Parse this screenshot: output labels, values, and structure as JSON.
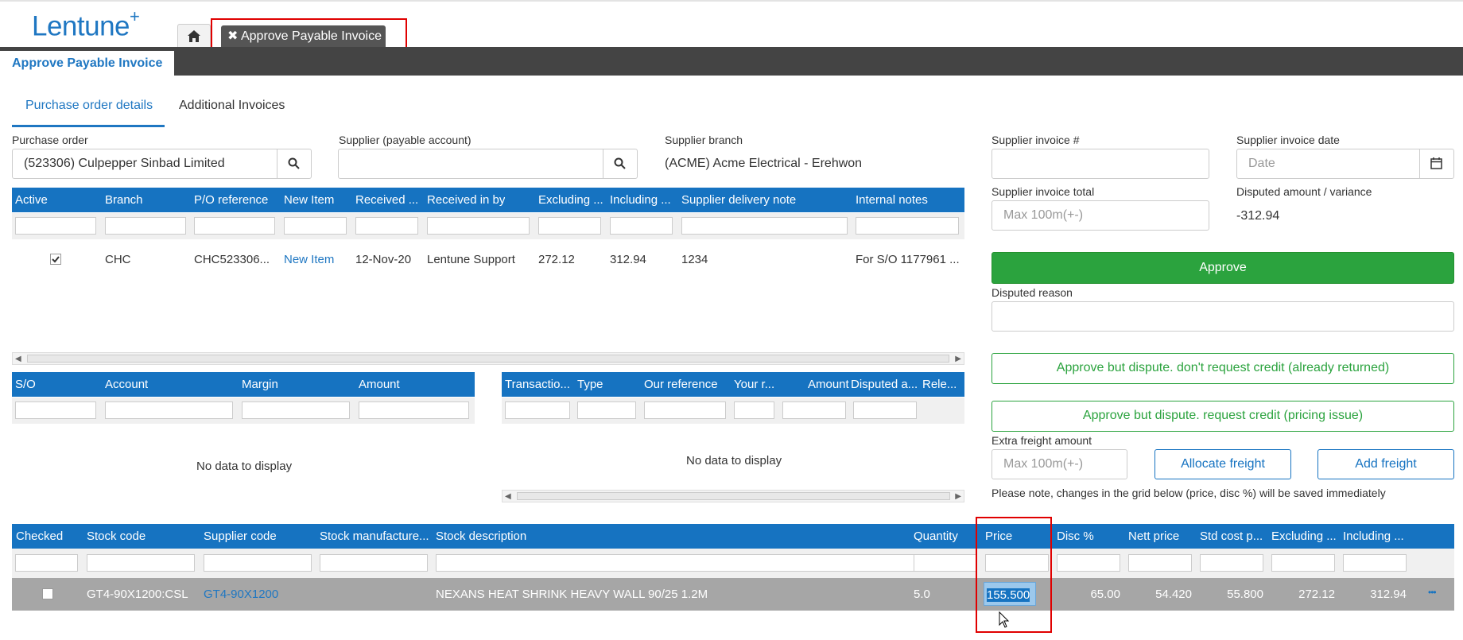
{
  "app": {
    "logo_text": "Lentune",
    "logo_plus": "+"
  },
  "tabs": {
    "home_icon": "home-icon",
    "active_label": "✖ Approve Payable Invoice"
  },
  "page_tab": "Approve Payable Invoice",
  "subtabs": [
    "Purchase order details",
    "Additional Invoices"
  ],
  "fields": {
    "purchase_order_label": "Purchase order",
    "purchase_order_value": "(523306) Culpepper Sinbad Limited",
    "supplier_label": "Supplier (payable account)",
    "supplier_value": "",
    "supplier_branch_label": "Supplier branch",
    "supplier_branch_value": "(ACME) Acme Electrical - Erehwon",
    "invoice_no_label": "Supplier invoice #",
    "invoice_date_label": "Supplier invoice date",
    "invoice_date_placeholder": "Date",
    "invoice_total_label": "Supplier invoice total",
    "invoice_total_placeholder": "Max 100m(+-)",
    "disputed_label": "Disputed amount / variance",
    "disputed_value": "-312.94",
    "disputed_reason_label": "Disputed reason",
    "extra_freight_label": "Extra freight amount",
    "extra_freight_placeholder": "Max 100m(+-)",
    "note": "Please note, changes in the grid below (price, disc %) will be saved immediately"
  },
  "buttons": {
    "approve": "Approve",
    "approve_dispute_no_credit": "Approve but dispute. don't request credit (already returned)",
    "approve_dispute_credit": "Approve but dispute. request credit (pricing issue)",
    "allocate_freight": "Allocate freight",
    "add_freight": "Add freight"
  },
  "po_grid": {
    "columns": [
      "Active",
      "Branch",
      "P/O reference",
      "New Item",
      "Received ...",
      "Received in by",
      "Excluding ...",
      "Including ...",
      "Supplier delivery note",
      "Internal notes"
    ],
    "row": {
      "branch": "CHC",
      "po_ref": "CHC523306...",
      "new_item": "New Item",
      "received": "12-Nov-20",
      "received_by": "Lentune Support",
      "excluding": "272.12",
      "including": "312.94",
      "delivery_note": "1234",
      "internal_notes": "For S/O 1177961 ..."
    }
  },
  "so_grid": {
    "columns": [
      "S/O",
      "Account",
      "Margin",
      "Amount"
    ],
    "empty": "No data to display"
  },
  "tx_grid": {
    "columns": [
      "Transactio...",
      "Type",
      "Our reference",
      "Your r...",
      "Amount",
      "Disputed a...",
      "Rele..."
    ],
    "empty": "No data to display"
  },
  "items_grid": {
    "columns": [
      "Checked",
      "Stock code",
      "Supplier code",
      "Stock manufacture...",
      "Stock description",
      "Quantity",
      "Price",
      "Disc %",
      "Nett price",
      "Std cost p...",
      "Excluding ...",
      "Including ..."
    ],
    "row": {
      "stock_code": "GT4-90X1200:CSL",
      "supplier_code": "GT4-90X1200",
      "description": "NEXANS HEAT SHRINK HEAVY WALL 90/25 1.2M",
      "quantity": "5.0",
      "price": "155.500",
      "disc": "65.00",
      "nett": "54.420",
      "std_cost": "55.800",
      "excluding": "272.12",
      "including": "312.94",
      "more": "•••"
    }
  },
  "colors": {
    "accent": "#1673c1",
    "approve_green": "#2ba33e",
    "highlight": "#e00000"
  }
}
